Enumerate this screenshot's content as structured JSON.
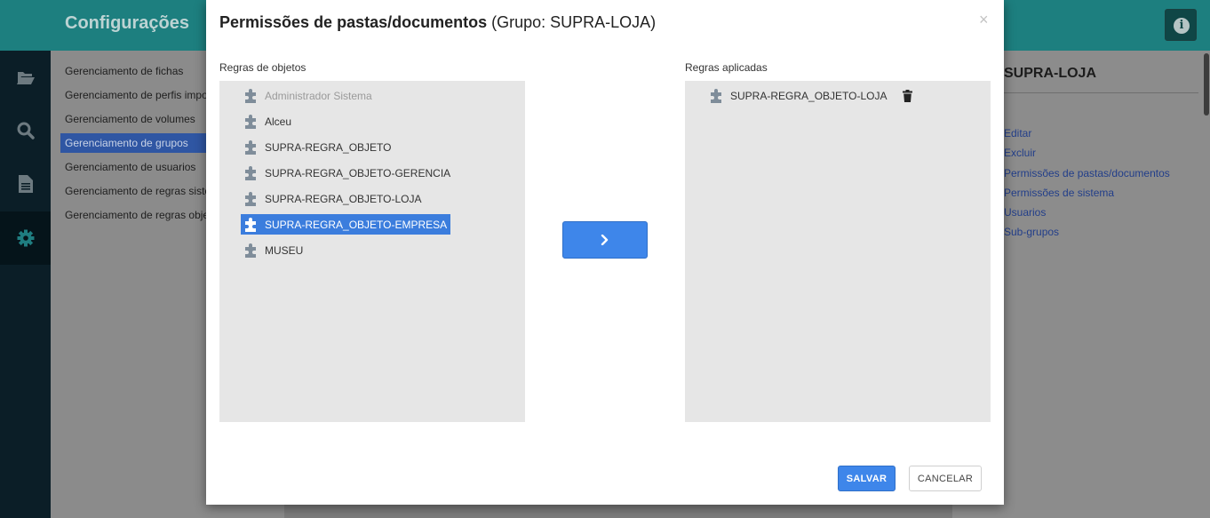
{
  "app": {
    "title": "Configurações",
    "info_icon": "info-icon",
    "rail_icons": [
      "folder-open-icon",
      "search-icon",
      "document-icon",
      "gear-icon"
    ],
    "menu": [
      {
        "label": "Gerenciamento de fichas",
        "active": false
      },
      {
        "label": "Gerenciamento de perfis importação",
        "active": false
      },
      {
        "label": "Gerenciamento de volumes",
        "active": false
      },
      {
        "label": "Gerenciamento de grupos",
        "active": true
      },
      {
        "label": "Gerenciamento de usuarios",
        "active": false
      },
      {
        "label": "Gerenciamento de regras sistema",
        "active": false
      },
      {
        "label": "Gerenciamento de regras objetos",
        "active": false
      }
    ],
    "right_panel": {
      "heading": "SUPRA-LOJA",
      "links": [
        "Editar",
        "Excluir",
        "Permissões de pastas/documentos",
        "Permissões de sistema",
        "Usuarios",
        "Sub-grupos"
      ]
    }
  },
  "modal": {
    "title_bold": "Permissões de pastas/documentos",
    "title_rest": " (Grupo: SUPRA-LOJA)",
    "close_label": "×",
    "left_label": "Regras de objetos",
    "right_label": "Regras aplicadas",
    "object_rules": [
      {
        "label": "Administrador Sistema",
        "state": "disabled"
      },
      {
        "label": "Alceu",
        "state": "normal"
      },
      {
        "label": "SUPRA-REGRA_OBJETO",
        "state": "normal"
      },
      {
        "label": "SUPRA-REGRA_OBJETO-GERENCIA",
        "state": "normal"
      },
      {
        "label": "SUPRA-REGRA_OBJETO-LOJA",
        "state": "normal"
      },
      {
        "label": "SUPRA-REGRA_OBJETO-EMPRESA",
        "state": "selected"
      },
      {
        "label": "MUSEU",
        "state": "normal"
      }
    ],
    "applied_rules": [
      {
        "label": "SUPRA-REGRA_OBJETO-LOJA"
      }
    ],
    "move_button_icon": "chevron-right-icon",
    "save_label": "SALVAR",
    "cancel_label": "CANCELAR"
  },
  "colors": {
    "accent": "#3e86ea",
    "selected": "#3b7ddd",
    "topbar": "#1d7f7f",
    "sidebar": "#0b1e27"
  }
}
